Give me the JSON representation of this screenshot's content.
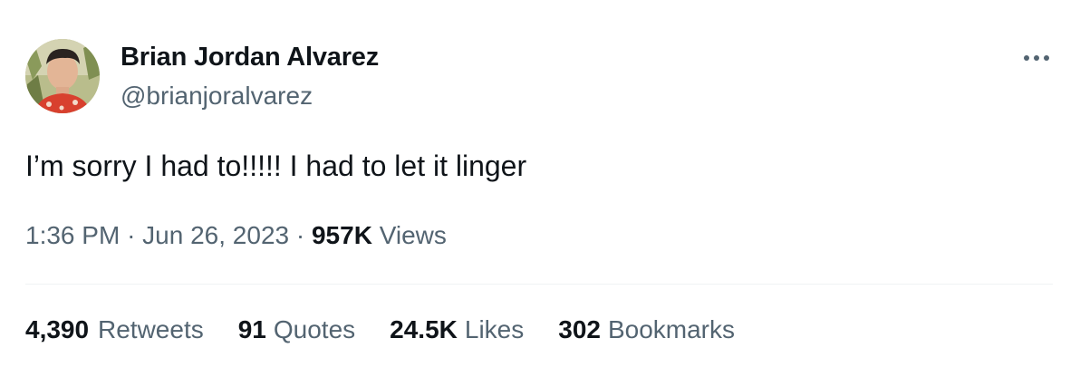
{
  "author": {
    "name": "Brian Jordan Alvarez",
    "handle": "@brianjoralvarez",
    "avatar_icon": "profile-photo"
  },
  "more_icon": "more-options-icon",
  "tweet": {
    "text": "I’m sorry I had to!!!!! I had to let it linger"
  },
  "meta": {
    "time": "1:36 PM",
    "separator": "·",
    "date": "Jun 26, 2023",
    "views_count": "957K",
    "views_label": "Views"
  },
  "stats": [
    {
      "count": "4,390",
      "label": "Retweets"
    },
    {
      "count": "91",
      "label": "Quotes"
    },
    {
      "count": "24.5K",
      "label": "Likes"
    },
    {
      "count": "302",
      "label": "Bookmarks"
    }
  ],
  "colors": {
    "text_primary": "#0f1419",
    "text_secondary": "#536471",
    "divider": "#eff3f4"
  }
}
